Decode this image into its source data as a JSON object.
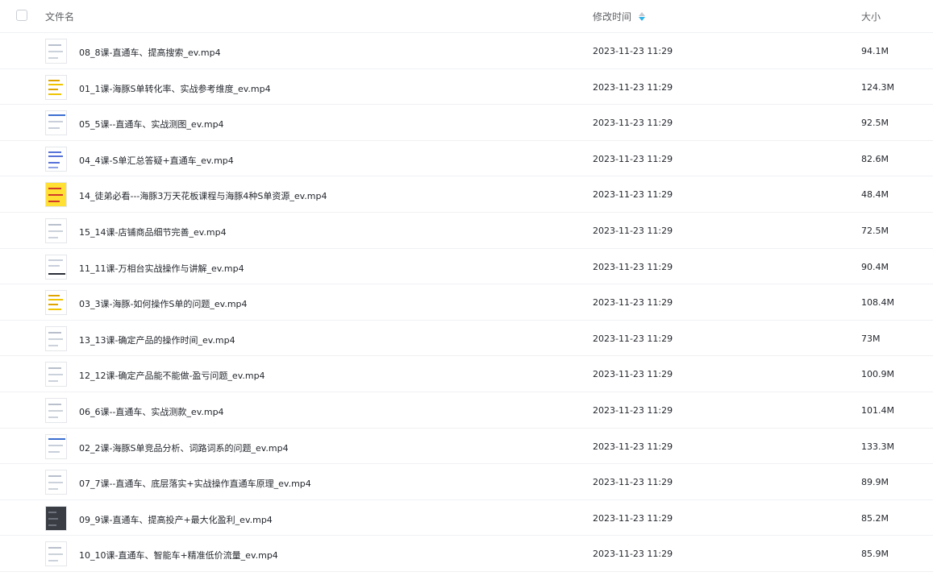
{
  "header": {
    "name_label": "文件名",
    "time_label": "修改时间",
    "size_label": "大小",
    "sort_icon": "sort-desc-icon"
  },
  "files": [
    {
      "name": "08_8课-直通车、提高搜索_ev.mp4",
      "time": "2023-11-23 11:29",
      "size": "94.1M",
      "thumb": "plain"
    },
    {
      "name": "01_1课-海豚S单转化率、实战参考维度_ev.mp4",
      "time": "2023-11-23 11:29",
      "size": "124.3M",
      "thumb": "yellow-text"
    },
    {
      "name": "05_5课--直通车、实战测图_ev.mp4",
      "time": "2023-11-23 11:29",
      "size": "92.5M",
      "thumb": "blue-header"
    },
    {
      "name": "04_4课-S单汇总答疑+直通车_ev.mp4",
      "time": "2023-11-23 11:29",
      "size": "82.6M",
      "thumb": "blue-text"
    },
    {
      "name": "14_徒弟必看---海豚3万天花板课程与海豚4种S单资源_ev.mp4",
      "time": "2023-11-23 11:29",
      "size": "48.4M",
      "thumb": "yellow"
    },
    {
      "name": "15_14课-店铺商品细节完善_ev.mp4",
      "time": "2023-11-23 11:29",
      "size": "72.5M",
      "thumb": "plain"
    },
    {
      "name": "11_11课-万相台实战操作与讲解_ev.mp4",
      "time": "2023-11-23 11:29",
      "size": "90.4M",
      "thumb": "dark-bottom"
    },
    {
      "name": "03_3课-海豚-如何操作S单的问题_ev.mp4",
      "time": "2023-11-23 11:29",
      "size": "108.4M",
      "thumb": "yellow-text"
    },
    {
      "name": "13_13课-确定产品的操作时间_ev.mp4",
      "time": "2023-11-23 11:29",
      "size": "73M",
      "thumb": "plain"
    },
    {
      "name": "12_12课-确定产品能不能做-盈亏问题_ev.mp4",
      "time": "2023-11-23 11:29",
      "size": "100.9M",
      "thumb": "plain"
    },
    {
      "name": "06_6课--直通车、实战测款_ev.mp4",
      "time": "2023-11-23 11:29",
      "size": "101.4M",
      "thumb": "plain"
    },
    {
      "name": "02_2课-海豚S单竞品分析、词路词系的问题_ev.mp4",
      "time": "2023-11-23 11:29",
      "size": "133.3M",
      "thumb": "blue-header"
    },
    {
      "name": "07_7课--直通车、底层落实+实战操作直通车原理_ev.mp4",
      "time": "2023-11-23 11:29",
      "size": "89.9M",
      "thumb": "plain"
    },
    {
      "name": "09_9课-直通车、提高投产+最大化盈利_ev.mp4",
      "time": "2023-11-23 11:29",
      "size": "85.2M",
      "thumb": "dark"
    },
    {
      "name": "10_10课-直通车、智能车+精准低价流量_ev.mp4",
      "time": "2023-11-23 11:29",
      "size": "85.9M",
      "thumb": "plain"
    }
  ]
}
